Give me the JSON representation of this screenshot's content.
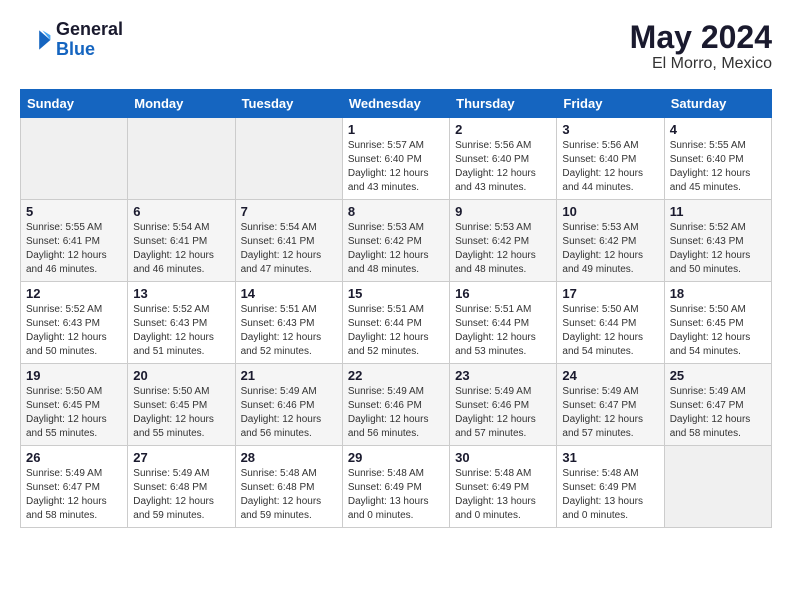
{
  "header": {
    "logo_general": "General",
    "logo_blue": "Blue",
    "month": "May 2024",
    "location": "El Morro, Mexico"
  },
  "days_of_week": [
    "Sunday",
    "Monday",
    "Tuesday",
    "Wednesday",
    "Thursday",
    "Friday",
    "Saturday"
  ],
  "weeks": [
    [
      {
        "day": "",
        "info": ""
      },
      {
        "day": "",
        "info": ""
      },
      {
        "day": "",
        "info": ""
      },
      {
        "day": "1",
        "info": "Sunrise: 5:57 AM\nSunset: 6:40 PM\nDaylight: 12 hours\nand 43 minutes."
      },
      {
        "day": "2",
        "info": "Sunrise: 5:56 AM\nSunset: 6:40 PM\nDaylight: 12 hours\nand 43 minutes."
      },
      {
        "day": "3",
        "info": "Sunrise: 5:56 AM\nSunset: 6:40 PM\nDaylight: 12 hours\nand 44 minutes."
      },
      {
        "day": "4",
        "info": "Sunrise: 5:55 AM\nSunset: 6:40 PM\nDaylight: 12 hours\nand 45 minutes."
      }
    ],
    [
      {
        "day": "5",
        "info": "Sunrise: 5:55 AM\nSunset: 6:41 PM\nDaylight: 12 hours\nand 46 minutes."
      },
      {
        "day": "6",
        "info": "Sunrise: 5:54 AM\nSunset: 6:41 PM\nDaylight: 12 hours\nand 46 minutes."
      },
      {
        "day": "7",
        "info": "Sunrise: 5:54 AM\nSunset: 6:41 PM\nDaylight: 12 hours\nand 47 minutes."
      },
      {
        "day": "8",
        "info": "Sunrise: 5:53 AM\nSunset: 6:42 PM\nDaylight: 12 hours\nand 48 minutes."
      },
      {
        "day": "9",
        "info": "Sunrise: 5:53 AM\nSunset: 6:42 PM\nDaylight: 12 hours\nand 48 minutes."
      },
      {
        "day": "10",
        "info": "Sunrise: 5:53 AM\nSunset: 6:42 PM\nDaylight: 12 hours\nand 49 minutes."
      },
      {
        "day": "11",
        "info": "Sunrise: 5:52 AM\nSunset: 6:43 PM\nDaylight: 12 hours\nand 50 minutes."
      }
    ],
    [
      {
        "day": "12",
        "info": "Sunrise: 5:52 AM\nSunset: 6:43 PM\nDaylight: 12 hours\nand 50 minutes."
      },
      {
        "day": "13",
        "info": "Sunrise: 5:52 AM\nSunset: 6:43 PM\nDaylight: 12 hours\nand 51 minutes."
      },
      {
        "day": "14",
        "info": "Sunrise: 5:51 AM\nSunset: 6:43 PM\nDaylight: 12 hours\nand 52 minutes."
      },
      {
        "day": "15",
        "info": "Sunrise: 5:51 AM\nSunset: 6:44 PM\nDaylight: 12 hours\nand 52 minutes."
      },
      {
        "day": "16",
        "info": "Sunrise: 5:51 AM\nSunset: 6:44 PM\nDaylight: 12 hours\nand 53 minutes."
      },
      {
        "day": "17",
        "info": "Sunrise: 5:50 AM\nSunset: 6:44 PM\nDaylight: 12 hours\nand 54 minutes."
      },
      {
        "day": "18",
        "info": "Sunrise: 5:50 AM\nSunset: 6:45 PM\nDaylight: 12 hours\nand 54 minutes."
      }
    ],
    [
      {
        "day": "19",
        "info": "Sunrise: 5:50 AM\nSunset: 6:45 PM\nDaylight: 12 hours\nand 55 minutes."
      },
      {
        "day": "20",
        "info": "Sunrise: 5:50 AM\nSunset: 6:45 PM\nDaylight: 12 hours\nand 55 minutes."
      },
      {
        "day": "21",
        "info": "Sunrise: 5:49 AM\nSunset: 6:46 PM\nDaylight: 12 hours\nand 56 minutes."
      },
      {
        "day": "22",
        "info": "Sunrise: 5:49 AM\nSunset: 6:46 PM\nDaylight: 12 hours\nand 56 minutes."
      },
      {
        "day": "23",
        "info": "Sunrise: 5:49 AM\nSunset: 6:46 PM\nDaylight: 12 hours\nand 57 minutes."
      },
      {
        "day": "24",
        "info": "Sunrise: 5:49 AM\nSunset: 6:47 PM\nDaylight: 12 hours\nand 57 minutes."
      },
      {
        "day": "25",
        "info": "Sunrise: 5:49 AM\nSunset: 6:47 PM\nDaylight: 12 hours\nand 58 minutes."
      }
    ],
    [
      {
        "day": "26",
        "info": "Sunrise: 5:49 AM\nSunset: 6:47 PM\nDaylight: 12 hours\nand 58 minutes."
      },
      {
        "day": "27",
        "info": "Sunrise: 5:49 AM\nSunset: 6:48 PM\nDaylight: 12 hours\nand 59 minutes."
      },
      {
        "day": "28",
        "info": "Sunrise: 5:48 AM\nSunset: 6:48 PM\nDaylight: 12 hours\nand 59 minutes."
      },
      {
        "day": "29",
        "info": "Sunrise: 5:48 AM\nSunset: 6:49 PM\nDaylight: 13 hours\nand 0 minutes."
      },
      {
        "day": "30",
        "info": "Sunrise: 5:48 AM\nSunset: 6:49 PM\nDaylight: 13 hours\nand 0 minutes."
      },
      {
        "day": "31",
        "info": "Sunrise: 5:48 AM\nSunset: 6:49 PM\nDaylight: 13 hours\nand 0 minutes."
      },
      {
        "day": "",
        "info": ""
      }
    ]
  ]
}
